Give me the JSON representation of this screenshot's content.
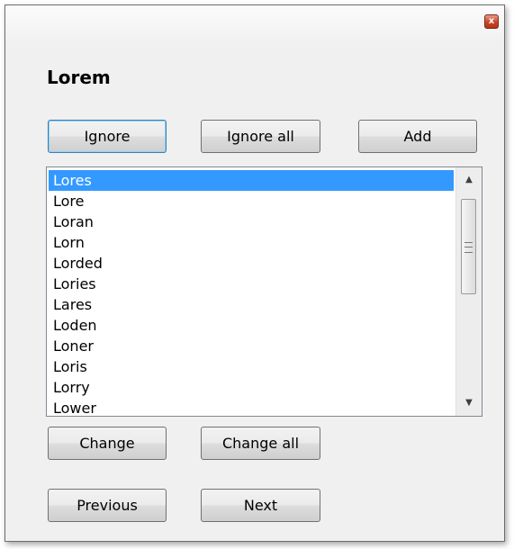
{
  "dialog": {
    "title": "Lorem",
    "close_glyph": "x"
  },
  "buttons": {
    "ignore": "Ignore",
    "ignore_all": "Ignore all",
    "add": "Add",
    "change": "Change",
    "change_all": "Change all",
    "previous": "Previous",
    "next": "Next"
  },
  "suggestions": {
    "selected_index": 0,
    "items": [
      "Lores",
      "Lore",
      "Loran",
      "Lorn",
      "Lorded",
      "Lories",
      "Lares",
      "Loden",
      "Loner",
      "Loris",
      "Lorry",
      "Lower"
    ]
  },
  "colors": {
    "selection": "#3399ff",
    "focus_border": "#3c7fb1",
    "close_button": "#c8432a"
  }
}
